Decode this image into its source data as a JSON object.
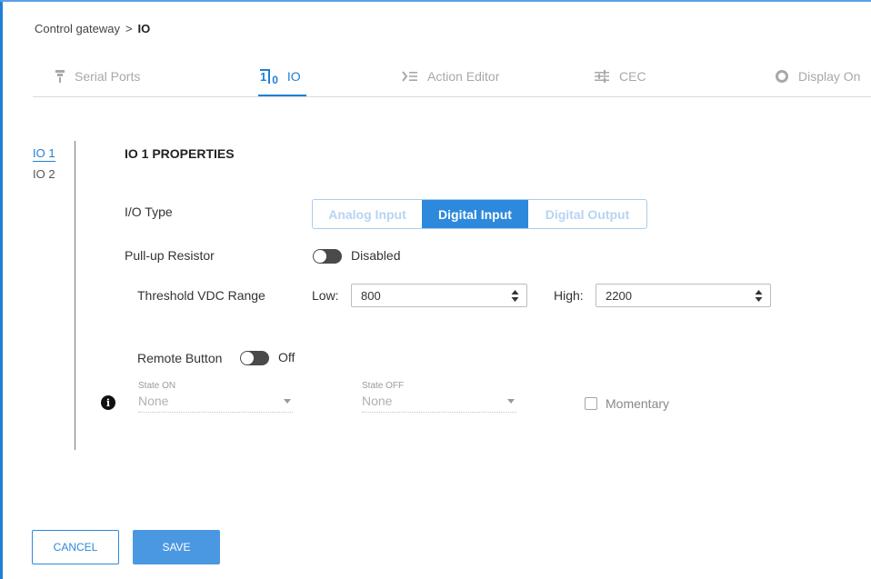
{
  "breadcrumb": {
    "parent": "Control gateway",
    "separator": ">",
    "current": "IO"
  },
  "tabs": [
    {
      "label": "Serial Ports",
      "icon": "serial-port-icon"
    },
    {
      "label": "IO",
      "icon": "io-icon",
      "active": true
    },
    {
      "label": "Action Editor",
      "icon": "action-editor-icon"
    },
    {
      "label": "CEC",
      "icon": "sliders-icon"
    },
    {
      "label": "Display On",
      "icon": "display-circle-icon"
    }
  ],
  "io_icon_text": {
    "one": "1",
    "zero": "0"
  },
  "sidebar": {
    "items": [
      {
        "label": "IO 1",
        "active": true
      },
      {
        "label": "IO 2"
      }
    ]
  },
  "section": {
    "title": "IO 1 PROPERTIES"
  },
  "io_type": {
    "label": "I/O Type",
    "options": [
      "Analog Input",
      "Digital Input",
      "Digital Output"
    ],
    "selected": "Digital Input"
  },
  "pullup": {
    "label": "Pull-up Resistor",
    "state": "Disabled"
  },
  "threshold": {
    "label": "Threshold VDC Range",
    "low_label": "Low:",
    "low_value": "800",
    "high_label": "High:",
    "high_value": "2200"
  },
  "remote_button": {
    "label": "Remote Button",
    "state": "Off"
  },
  "state_on": {
    "label": "State ON",
    "value": "None"
  },
  "state_off": {
    "label": "State OFF",
    "value": "None"
  },
  "momentary": {
    "label": "Momentary",
    "checked": false
  },
  "info_icon": {
    "symbol": "i"
  },
  "actions": {
    "cancel": "CANCEL",
    "save": "SAVE"
  },
  "colors": {
    "accent": "#1f7fd6",
    "accent_fill": "#2d89dc",
    "save_fill": "#4b98e2",
    "toggle": "#4a4a4a"
  }
}
